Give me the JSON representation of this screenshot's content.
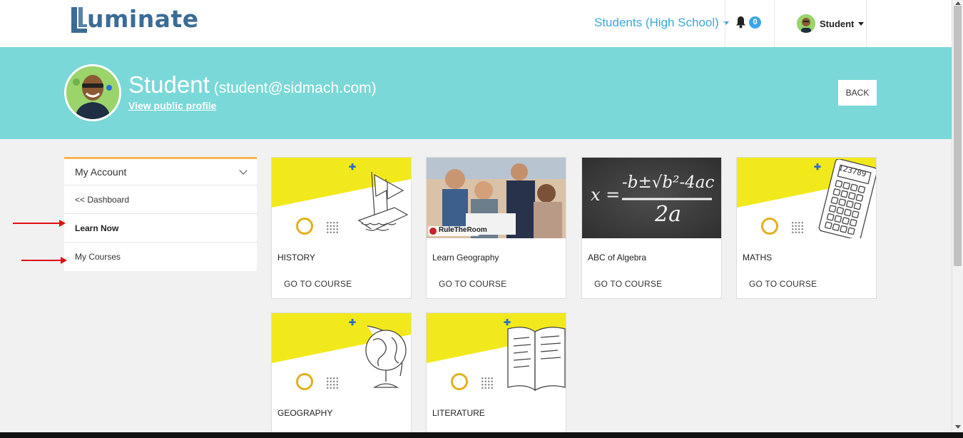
{
  "header": {
    "logo_text": "uminate",
    "audience_label": "Students (High School)",
    "notification_count": "0",
    "user_label": "Student"
  },
  "profile": {
    "name": "Student",
    "email": "(student@sidmach.com)",
    "public_profile_link": "View public profile",
    "back_label": "BACK"
  },
  "sidebar": {
    "heading": "My Account",
    "items": [
      {
        "label": "<< Dashboard"
      },
      {
        "label": "Learn Now"
      },
      {
        "label": "My Courses"
      }
    ]
  },
  "courses": [
    {
      "title": "HISTORY",
      "action": "GO TO COURSE",
      "icon": "shipwreck-sketch"
    },
    {
      "title": "Learn Geography",
      "action": "GO TO COURSE",
      "icon": "classroom-photo",
      "watermark": "RuleTheRoom"
    },
    {
      "title": "ABC of Algebra",
      "action": "GO TO COURSE",
      "icon": "quadratic-formula-chalkboard",
      "formula_top": "-b±√b²-4ac",
      "formula_left": "x =",
      "formula_bottom": "2a"
    },
    {
      "title": "MATHS",
      "action": "GO TO COURSE",
      "icon": "calculator-sketch",
      "calc_display": "123789"
    },
    {
      "title": "GEOGRAPHY",
      "action": "",
      "icon": "globe-sketch"
    },
    {
      "title": "LITERATURE",
      "action": "",
      "icon": "book-sketch"
    }
  ],
  "colors": {
    "banner": "#7ad8d8",
    "accent_blue": "#3aa7d9",
    "sidebar_top_border": "#f6b34f",
    "card_yellow": "#f2e91c",
    "annotation_arrow": "#e01010"
  }
}
